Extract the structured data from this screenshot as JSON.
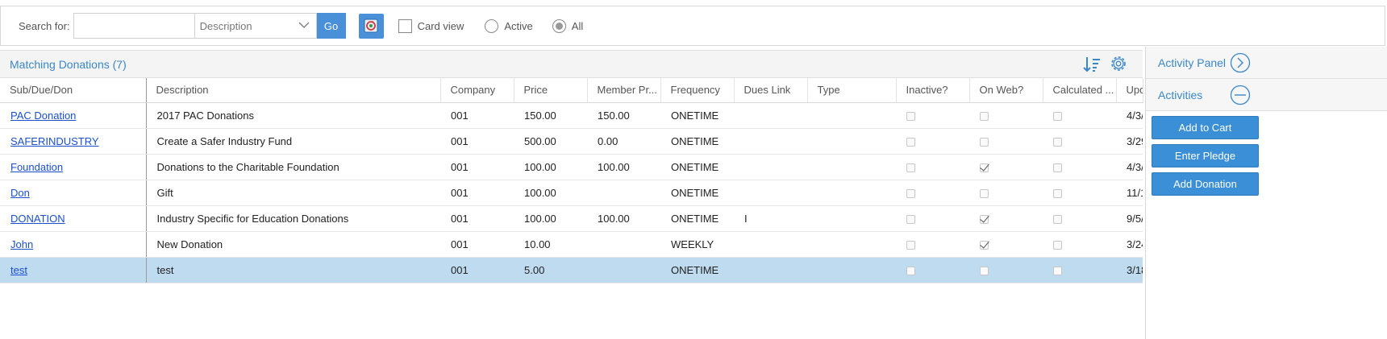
{
  "toolbar": {
    "search_label": "Search for:",
    "search_value": "",
    "field_select": "Description",
    "go_label": "Go",
    "card_view_label": "Card view",
    "card_view_checked": false,
    "radio_active_label": "Active",
    "radio_all_label": "All",
    "selected_radio": "All"
  },
  "grid": {
    "title": "Matching Donations (7)",
    "columns": [
      "Sub/Due/Don",
      "Description",
      "Company",
      "Price",
      "Member Pr...",
      "Frequency",
      "Dues Link",
      "Type",
      "Inactive?",
      "On Web?",
      "Calculated ...",
      "Upd"
    ],
    "rows": [
      {
        "code": "PAC Donation",
        "description": "2017 PAC Donations",
        "company": "001",
        "price": "150.00",
        "member_price": "150.00",
        "frequency": "ONETIME",
        "dues_link": "",
        "type": "",
        "inactive": false,
        "on_web": false,
        "calculated": false,
        "updated": "4/3/"
      },
      {
        "code": "SAFERINDUSTRY",
        "description": "Create a Safer Industry Fund",
        "company": "001",
        "price": "500.00",
        "member_price": "0.00",
        "frequency": "ONETIME",
        "dues_link": "",
        "type": "",
        "inactive": false,
        "on_web": false,
        "calculated": false,
        "updated": "3/29"
      },
      {
        "code": "Foundation",
        "description": "Donations to the Charitable Foundation",
        "company": "001",
        "price": "100.00",
        "member_price": "100.00",
        "frequency": "ONETIME",
        "dues_link": "",
        "type": "",
        "inactive": false,
        "on_web": true,
        "calculated": false,
        "updated": "4/3/"
      },
      {
        "code": "Don",
        "description": "Gift",
        "company": "001",
        "price": "100.00",
        "member_price": "",
        "frequency": "ONETIME",
        "dues_link": "",
        "type": "",
        "inactive": false,
        "on_web": false,
        "calculated": false,
        "updated": "11/1"
      },
      {
        "code": "DONATION",
        "description": "Industry Specific for Education Donations",
        "company": "001",
        "price": "100.00",
        "member_price": "100.00",
        "frequency": "ONETIME",
        "dues_link": "I",
        "type": "",
        "inactive": false,
        "on_web": true,
        "calculated": false,
        "updated": "9/5/"
      },
      {
        "code": "John",
        "description": "New Donation",
        "company": "001",
        "price": "10.00",
        "member_price": "",
        "frequency": "WEEKLY",
        "dues_link": "",
        "type": "",
        "inactive": false,
        "on_web": true,
        "calculated": false,
        "updated": "3/24"
      },
      {
        "code": "test",
        "description": "test",
        "company": "001",
        "price": "5.00",
        "member_price": "",
        "frequency": "ONETIME",
        "dues_link": "",
        "type": "",
        "inactive": false,
        "on_web": false,
        "calculated": false,
        "updated": "3/18",
        "selected": true
      }
    ]
  },
  "side_panel": {
    "activity_panel_label": "Activity Panel",
    "activities_label": "Activities",
    "buttons": [
      "Add to Cart",
      "Enter Pledge",
      "Add Donation"
    ]
  },
  "colors": {
    "accent": "#4a90d9",
    "title_blue": "#3a87c8",
    "selected_row": "#bfdbf0",
    "link": "#1a4fd0"
  }
}
